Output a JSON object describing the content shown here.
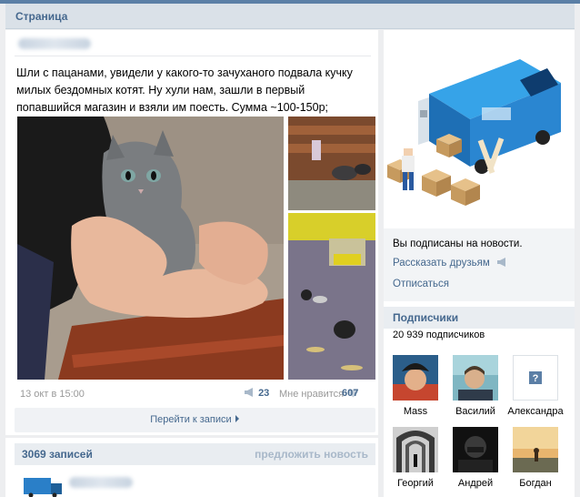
{
  "header": {
    "title": "Страница"
  },
  "post": {
    "text": "Шли с пацанами, увидели у какого-то зачуханого подвала кучку милых бездомных котят. Ну хули нам, зашли в первый попавшийся магазин и взяли им поесть. Сумма ~100-150р;",
    "date": "13 окт в 15:00",
    "share_count": "23",
    "likes_label": "Мне нравится",
    "likes_count": "607",
    "goto_label": "Перейти к записи"
  },
  "records": {
    "count": "3069 записей",
    "suggest": "предложить новость"
  },
  "subscription": {
    "status": "Вы подписаны на новости.",
    "tell_friends": "Рассказать друзьям",
    "unsubscribe": "Отписаться"
  },
  "subscribers": {
    "title": "Подписчики",
    "count": "20 939 подписчиков",
    "members": [
      {
        "name": "Mass"
      },
      {
        "name": "Василий"
      },
      {
        "name": "Александра"
      },
      {
        "name": "Георгий"
      },
      {
        "name": "Андрей"
      },
      {
        "name": "Богдан"
      }
    ]
  },
  "colors": {
    "link": "#45688e",
    "header_bg": "#dae1e8",
    "topbar": "#5b7fa6"
  },
  "icons": [
    "megaphone-icon",
    "heart-icon",
    "chevron-right-icon",
    "question-icon",
    "truck-icon"
  ]
}
